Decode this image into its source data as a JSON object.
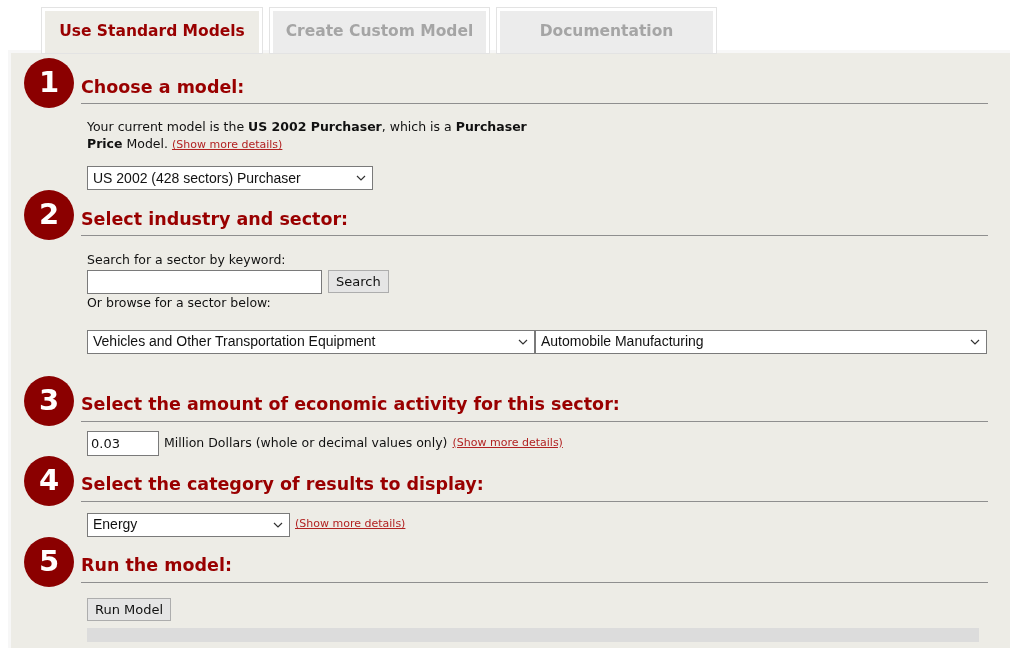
{
  "tabs": [
    {
      "label": "Use Standard Models",
      "selected": true
    },
    {
      "label": "Create Custom Model",
      "selected": false
    },
    {
      "label": "Documentation",
      "selected": false
    }
  ],
  "sections": [
    {
      "kind": "model",
      "number": "1",
      "title": "Choose a model:",
      "description": "Your current model is the **US 2002 Purchaser**, which is a **Purchaser Price** Model.",
      "link": "(Show more details)",
      "select": "US 2002 (428 sectors) Purchaser"
    },
    {
      "kind": "sector",
      "number": "2",
      "title": "Select industry and sector:",
      "search_label": "Search for a sector by keyword:",
      "search_button": "Search",
      "browse_label": "Or browse for a sector below:",
      "industry_select": "Vehicles and Other Transportation Equipment",
      "sector_select": "Automobile Manufacturing"
    },
    {
      "kind": "amount",
      "number": "3",
      "title": "Select the amount of economic activity for this sector:",
      "value": "0.03",
      "unit": "Million Dollars (whole or decimal values only)",
      "link": "(Show more details)"
    },
    {
      "kind": "category",
      "number": "4",
      "title": "Select the category of results to display:",
      "select": "Energy",
      "link": "(Show more details)"
    },
    {
      "kind": "run",
      "number": "5",
      "title": "Run the model:",
      "button": "Run Model"
    }
  ]
}
